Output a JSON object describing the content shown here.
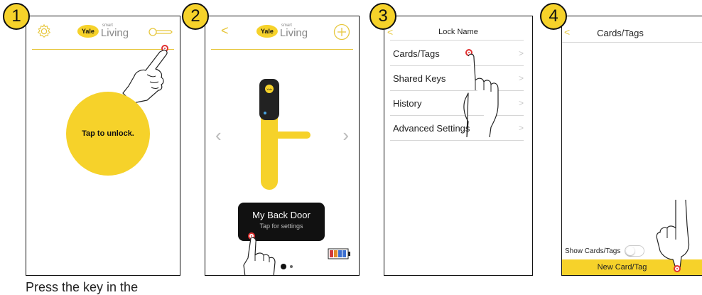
{
  "steps": [
    "1",
    "2",
    "3",
    "4"
  ],
  "brand": {
    "yale": "Yale",
    "smart": "smart",
    "living": "Living"
  },
  "screen1": {
    "unlock_label": "Tap to unlock."
  },
  "screen2": {
    "lock_name": "My Back Door",
    "lock_sub": "Tap for settings",
    "prev_glyph": "‹",
    "next_glyph": "›",
    "back_glyph": "<"
  },
  "screen3": {
    "header": "Lock Name",
    "menu": [
      {
        "label": "Cards/Tags",
        "chevron": ">"
      },
      {
        "label": "Shared Keys",
        "chevron": ">"
      },
      {
        "label": "History",
        "chevron": ">"
      },
      {
        "label": "Advanced Settings",
        "chevron": ">"
      }
    ]
  },
  "screen4": {
    "header": "Cards/Tags",
    "back_glyph": "<",
    "show_label": "Show Cards/Tags",
    "new_button": "New Card/Tag"
  },
  "caption": "Press the key in the",
  "colors": {
    "accent": "#f6d22a",
    "accent_line": "#e7c73d",
    "tap_ring": "#e03030",
    "dark_panel": "#111111"
  }
}
